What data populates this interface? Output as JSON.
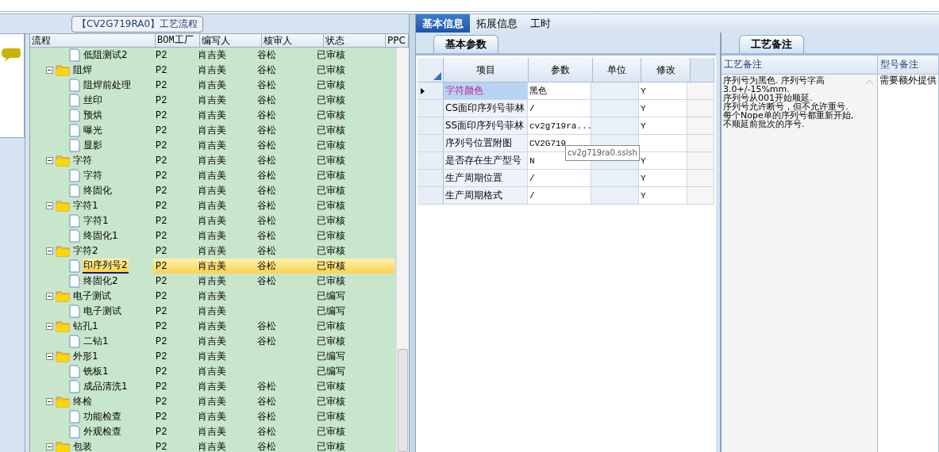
{
  "tree": {
    "title": "【CV2G719RA0】工艺流程",
    "columns": [
      "流程",
      "BOM工厂",
      "编写人",
      "核审人",
      "状态",
      "PPC"
    ],
    "rows": [
      {
        "kind": "continued",
        "children": [
          {
            "kind": "file",
            "name": "低阻测试2",
            "factory": "P2",
            "writer": "肖吉美",
            "reviewer": "谷松",
            "status": "已审核",
            "selected": false
          }
        ]
      },
      {
        "kind": "folder",
        "name": "阻焊",
        "factory": "P2",
        "writer": "肖吉美",
        "reviewer": "谷松",
        "status": "已审核",
        "expanded": true,
        "selected": false,
        "children": [
          {
            "kind": "file",
            "name": "阻焊前处理",
            "factory": "P2",
            "writer": "肖吉美",
            "reviewer": "谷松",
            "status": "已审核",
            "selected": false
          },
          {
            "kind": "file",
            "name": "丝印",
            "factory": "P2",
            "writer": "肖吉美",
            "reviewer": "谷松",
            "status": "已审核",
            "selected": false
          },
          {
            "kind": "file",
            "name": "预烘",
            "factory": "P2",
            "writer": "肖吉美",
            "reviewer": "谷松",
            "status": "已审核",
            "selected": false
          },
          {
            "kind": "file",
            "name": "曝光",
            "factory": "P2",
            "writer": "肖吉美",
            "reviewer": "谷松",
            "status": "已审核",
            "selected": false
          },
          {
            "kind": "file",
            "name": "显影",
            "factory": "P2",
            "writer": "肖吉美",
            "reviewer": "谷松",
            "status": "已审核",
            "selected": false
          }
        ]
      },
      {
        "kind": "folder",
        "name": "字符",
        "factory": "P2",
        "writer": "肖吉美",
        "reviewer": "谷松",
        "status": "已审核",
        "expanded": true,
        "selected": false,
        "children": [
          {
            "kind": "file",
            "name": "字符",
            "factory": "P2",
            "writer": "肖吉美",
            "reviewer": "谷松",
            "status": "已审核",
            "selected": false
          },
          {
            "kind": "file",
            "name": "终固化",
            "factory": "P2",
            "writer": "肖吉美",
            "reviewer": "谷松",
            "status": "已审核",
            "selected": false
          }
        ]
      },
      {
        "kind": "folder",
        "name": "字符1",
        "factory": "P2",
        "writer": "肖吉美",
        "reviewer": "谷松",
        "status": "已审核",
        "expanded": true,
        "selected": false,
        "children": [
          {
            "kind": "file",
            "name": "字符1",
            "factory": "P2",
            "writer": "肖吉美",
            "reviewer": "谷松",
            "status": "已审核",
            "selected": false
          },
          {
            "kind": "file",
            "name": "终固化1",
            "factory": "P2",
            "writer": "肖吉美",
            "reviewer": "谷松",
            "status": "已审核",
            "selected": false
          }
        ]
      },
      {
        "kind": "folder",
        "name": "字符2",
        "factory": "P2",
        "writer": "肖吉美",
        "reviewer": "谷松",
        "status": "已审核",
        "expanded": true,
        "selected": false,
        "children": [
          {
            "kind": "file",
            "name": "印序列号2",
            "factory": "P2",
            "writer": "肖吉美",
            "reviewer": "谷松",
            "status": "已审核",
            "selected": true
          },
          {
            "kind": "file",
            "name": "终固化2",
            "factory": "P2",
            "writer": "肖吉美",
            "reviewer": "谷松",
            "status": "已审核",
            "selected": false
          }
        ]
      },
      {
        "kind": "folder",
        "name": "电子测试",
        "factory": "P2",
        "writer": "肖吉美",
        "status": "已编写",
        "expanded": true,
        "selected": false,
        "children": [
          {
            "kind": "file",
            "name": "电子测试",
            "factory": "P2",
            "writer": "肖吉美",
            "status": "已编写",
            "selected": false
          }
        ]
      },
      {
        "kind": "folder",
        "name": "钻孔1",
        "factory": "P2",
        "writer": "肖吉美",
        "reviewer": "谷松",
        "status": "已审核",
        "expanded": true,
        "selected": false,
        "children": [
          {
            "kind": "file",
            "name": "二钻1",
            "factory": "P2",
            "writer": "肖吉美",
            "reviewer": "谷松",
            "status": "已审核",
            "selected": false
          }
        ]
      },
      {
        "kind": "folder",
        "name": "外形1",
        "factory": "P2",
        "writer": "肖吉美",
        "status": "已编写",
        "expanded": true,
        "selected": false,
        "children": [
          {
            "kind": "file",
            "name": "铣板1",
            "factory": "P2",
            "writer": "肖吉美",
            "status": "已编写",
            "selected": false
          },
          {
            "kind": "file",
            "name": "成品清洗1",
            "factory": "P2",
            "writer": "肖吉美",
            "reviewer": "谷松",
            "status": "已审核",
            "selected": false
          }
        ]
      },
      {
        "kind": "folder",
        "name": "终检",
        "factory": "P2",
        "writer": "肖吉美",
        "reviewer": "谷松",
        "status": "已审核",
        "expanded": true,
        "selected": false,
        "children": [
          {
            "kind": "file",
            "name": "功能检查",
            "factory": "P2",
            "writer": "肖吉美",
            "reviewer": "谷松",
            "status": "已审核",
            "selected": false
          },
          {
            "kind": "file",
            "name": "外观检查",
            "factory": "P2",
            "writer": "肖吉美",
            "reviewer": "谷松",
            "status": "已审核",
            "selected": false
          }
        ]
      },
      {
        "kind": "folder",
        "name": "包装",
        "factory": "P2",
        "writer": "肖吉美",
        "reviewer": "谷松",
        "status": "已审核",
        "expanded": true,
        "selected": false
      }
    ]
  },
  "tabs": [
    {
      "label": "基本信息",
      "selected": true
    },
    {
      "label": "拓展信息",
      "selected": false
    },
    {
      "label": "工时",
      "selected": false
    }
  ],
  "params": {
    "tab": "基本参数",
    "columns": [
      "项目",
      "参数",
      "单位",
      "修改"
    ],
    "rows": [
      {
        "item": "字符颜色",
        "value": "黑色",
        "modified": "Y",
        "selected": true
      },
      {
        "item": "CS面印序列号菲林",
        "value": "/",
        "modified": "Y",
        "selected": false
      },
      {
        "item": "SS面印序列号菲林",
        "value": "cv2g719ra...",
        "modified": "Y",
        "selected": false
      },
      {
        "item": "序列号位置附图",
        "value": "CV2G719",
        "selected": false
      },
      {
        "item": "是否存在生产型号",
        "value": "N",
        "modified": "Y",
        "selected": false
      },
      {
        "item": "生产周期位置",
        "value": "/",
        "modified": "Y",
        "selected": false
      },
      {
        "item": "生产周期格式",
        "value": "/",
        "modified": "Y",
        "selected": false
      }
    ],
    "tooltip": "cv2g719ra0.sslsh"
  },
  "notes": {
    "tab": "工艺备注",
    "columns": [
      "工艺备注",
      "型号备注"
    ],
    "process_note": "序列号为黑色. 序列号字高\n3.0+/-15%mm.\n序列号从001开始顺延.\n序列号允许断号，但不允许重号.\n每个Nope单的序列号都重新开始,\n不顺延前批次的序号.",
    "model_note": "需要额外提供"
  }
}
